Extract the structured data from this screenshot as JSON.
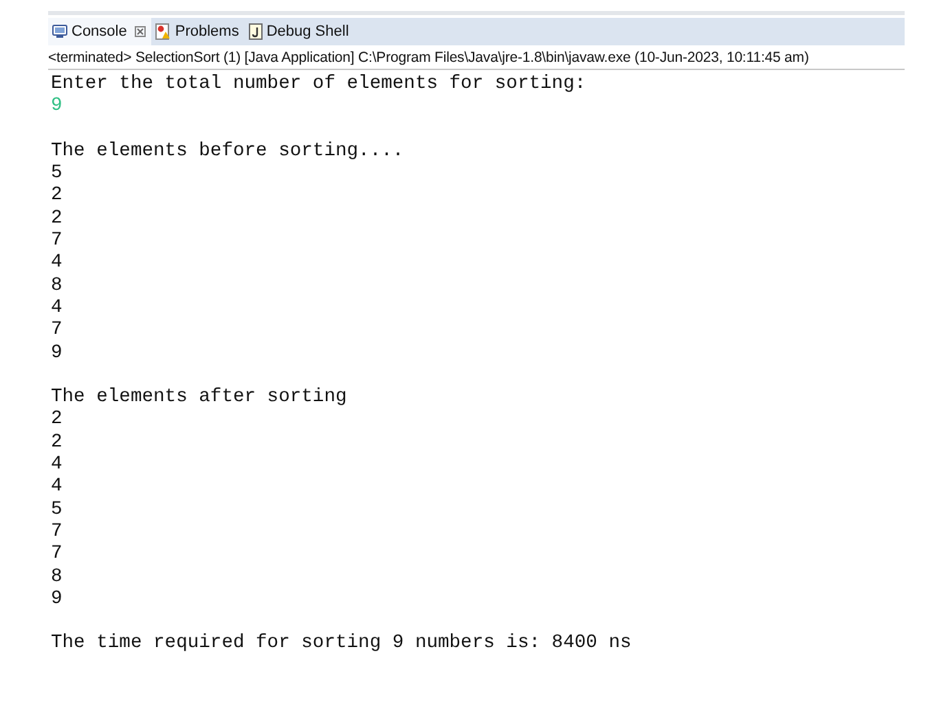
{
  "tabs": [
    {
      "label": "Console",
      "selected": true,
      "closable": true,
      "kind": "console"
    },
    {
      "label": "Problems",
      "selected": false,
      "closable": false,
      "kind": "problems"
    },
    {
      "label": "Debug Shell",
      "selected": false,
      "closable": false,
      "kind": "debug"
    }
  ],
  "status": "<terminated> SelectionSort (1) [Java Application] C:\\Program Files\\Java\\jre-1.8\\bin\\javaw.exe (10-Jun-2023, 10:11:45 am)",
  "console_blocks": [
    {
      "lines": [
        {
          "text": "Enter the total number of elements for sorting:",
          "kind": "output"
        },
        {
          "text": "9",
          "kind": "input"
        }
      ]
    },
    {
      "lines": [
        {
          "text": "The elements before sorting....",
          "kind": "output"
        },
        {
          "text": "5",
          "kind": "output"
        },
        {
          "text": "2",
          "kind": "output"
        },
        {
          "text": "2",
          "kind": "output"
        },
        {
          "text": "7",
          "kind": "output"
        },
        {
          "text": "4",
          "kind": "output"
        },
        {
          "text": "8",
          "kind": "output"
        },
        {
          "text": "4",
          "kind": "output"
        },
        {
          "text": "7",
          "kind": "output"
        },
        {
          "text": "9",
          "kind": "output"
        }
      ]
    },
    {
      "lines": [
        {
          "text": "The elements after sorting",
          "kind": "output"
        },
        {
          "text": "2",
          "kind": "output"
        },
        {
          "text": "2",
          "kind": "output"
        },
        {
          "text": "4",
          "kind": "output"
        },
        {
          "text": "4",
          "kind": "output"
        },
        {
          "text": "5",
          "kind": "output"
        },
        {
          "text": "7",
          "kind": "output"
        },
        {
          "text": "7",
          "kind": "output"
        },
        {
          "text": "8",
          "kind": "output"
        },
        {
          "text": "9",
          "kind": "output"
        }
      ]
    },
    {
      "lines": [
        {
          "text": "The time required for sorting 9 numbers is: 8400 ns",
          "kind": "output"
        }
      ]
    }
  ]
}
